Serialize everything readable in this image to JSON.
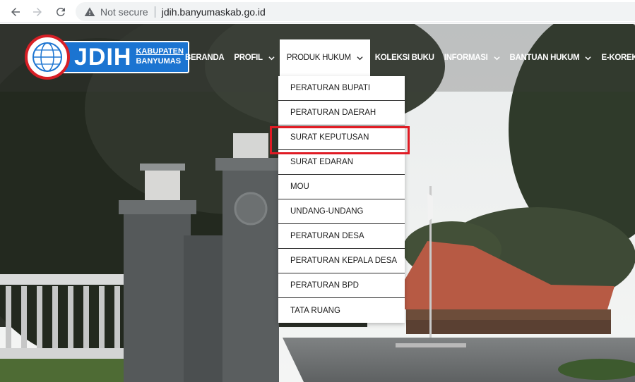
{
  "browser": {
    "security_label": "Not secure",
    "url": "jdih.banyumaskab.go.id"
  },
  "logo": {
    "emblem_text": "JDIH",
    "title": "JDIH",
    "subtitle_line1": "KABUPATEN",
    "subtitle_line2": "BANYUMAS",
    "colors": {
      "red": "#d71f26",
      "blue": "#1b74d1"
    }
  },
  "menu": {
    "items": [
      {
        "label": "BERANDA",
        "has_dropdown": false
      },
      {
        "label": "PROFIL",
        "has_dropdown": true
      },
      {
        "label": "PRODUK HUKUM",
        "has_dropdown": true,
        "active": true
      },
      {
        "label": "KOLEKSI BUKU",
        "has_dropdown": false
      },
      {
        "label": "INFORMASI",
        "has_dropdown": true
      },
      {
        "label": "BANTUAN HUKUM",
        "has_dropdown": true
      },
      {
        "label": "E-KOREKSI",
        "has_dropdown": false
      }
    ]
  },
  "dropdown": {
    "items": [
      {
        "label": "PERATURAN BUPATI"
      },
      {
        "label": "PERATURAN DAERAH"
      },
      {
        "label": "SURAT KEPUTUSAN",
        "highlighted": true
      },
      {
        "label": "SURAT EDARAN"
      },
      {
        "label": "MOU"
      },
      {
        "label": "UNDANG-UNDANG"
      },
      {
        "label": "PERATURAN DESA"
      },
      {
        "label": "PERATURAN KEPALA DESA"
      },
      {
        "label": "PERATURAN BPD"
      },
      {
        "label": "TATA RUANG"
      }
    ]
  },
  "highlight_color": "#e01b24"
}
